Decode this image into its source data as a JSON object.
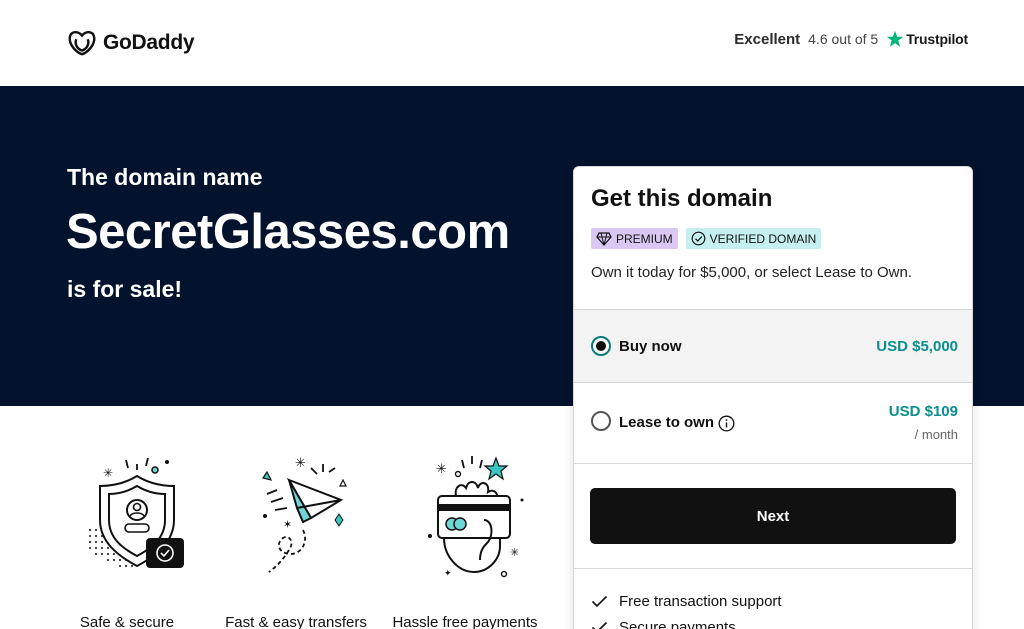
{
  "header": {
    "logo_text": "GoDaddy",
    "rating_word": "Excellent",
    "rating_score": "4.6 out of 5",
    "trustpilot": "Trustpilot"
  },
  "hero": {
    "kicker": "The domain name",
    "domain": "SecretGlasses.com",
    "for_sale": "is for sale!"
  },
  "features": [
    {
      "label": "Safe & secure",
      "icon": "shield-icon"
    },
    {
      "label": "Fast & easy transfers",
      "icon": "paper-plane-icon"
    },
    {
      "label": "Hassle free payments",
      "icon": "credit-card-hand-icon"
    }
  ],
  "card": {
    "title": "Get this domain",
    "badge_premium": "PREMIUM",
    "badge_verified": "VERIFIED DOMAIN",
    "subtitle": "Own it today for $5,000, or select Lease to Own.",
    "buy_label": "Buy now",
    "buy_price": "USD $5,000",
    "lease_label": "Lease to own",
    "lease_price": "USD $109",
    "lease_per": "/ month",
    "next_label": "Next",
    "benefits": [
      "Free transaction support",
      "Secure payments"
    ],
    "selected_option": "Buy now"
  },
  "colors": {
    "hero_bg": "#03132d",
    "accent_teal": "#0a8f8f",
    "button_bg": "#111111",
    "premium_badge": "#d9c8f4",
    "verified_badge": "#c6f0f0"
  }
}
